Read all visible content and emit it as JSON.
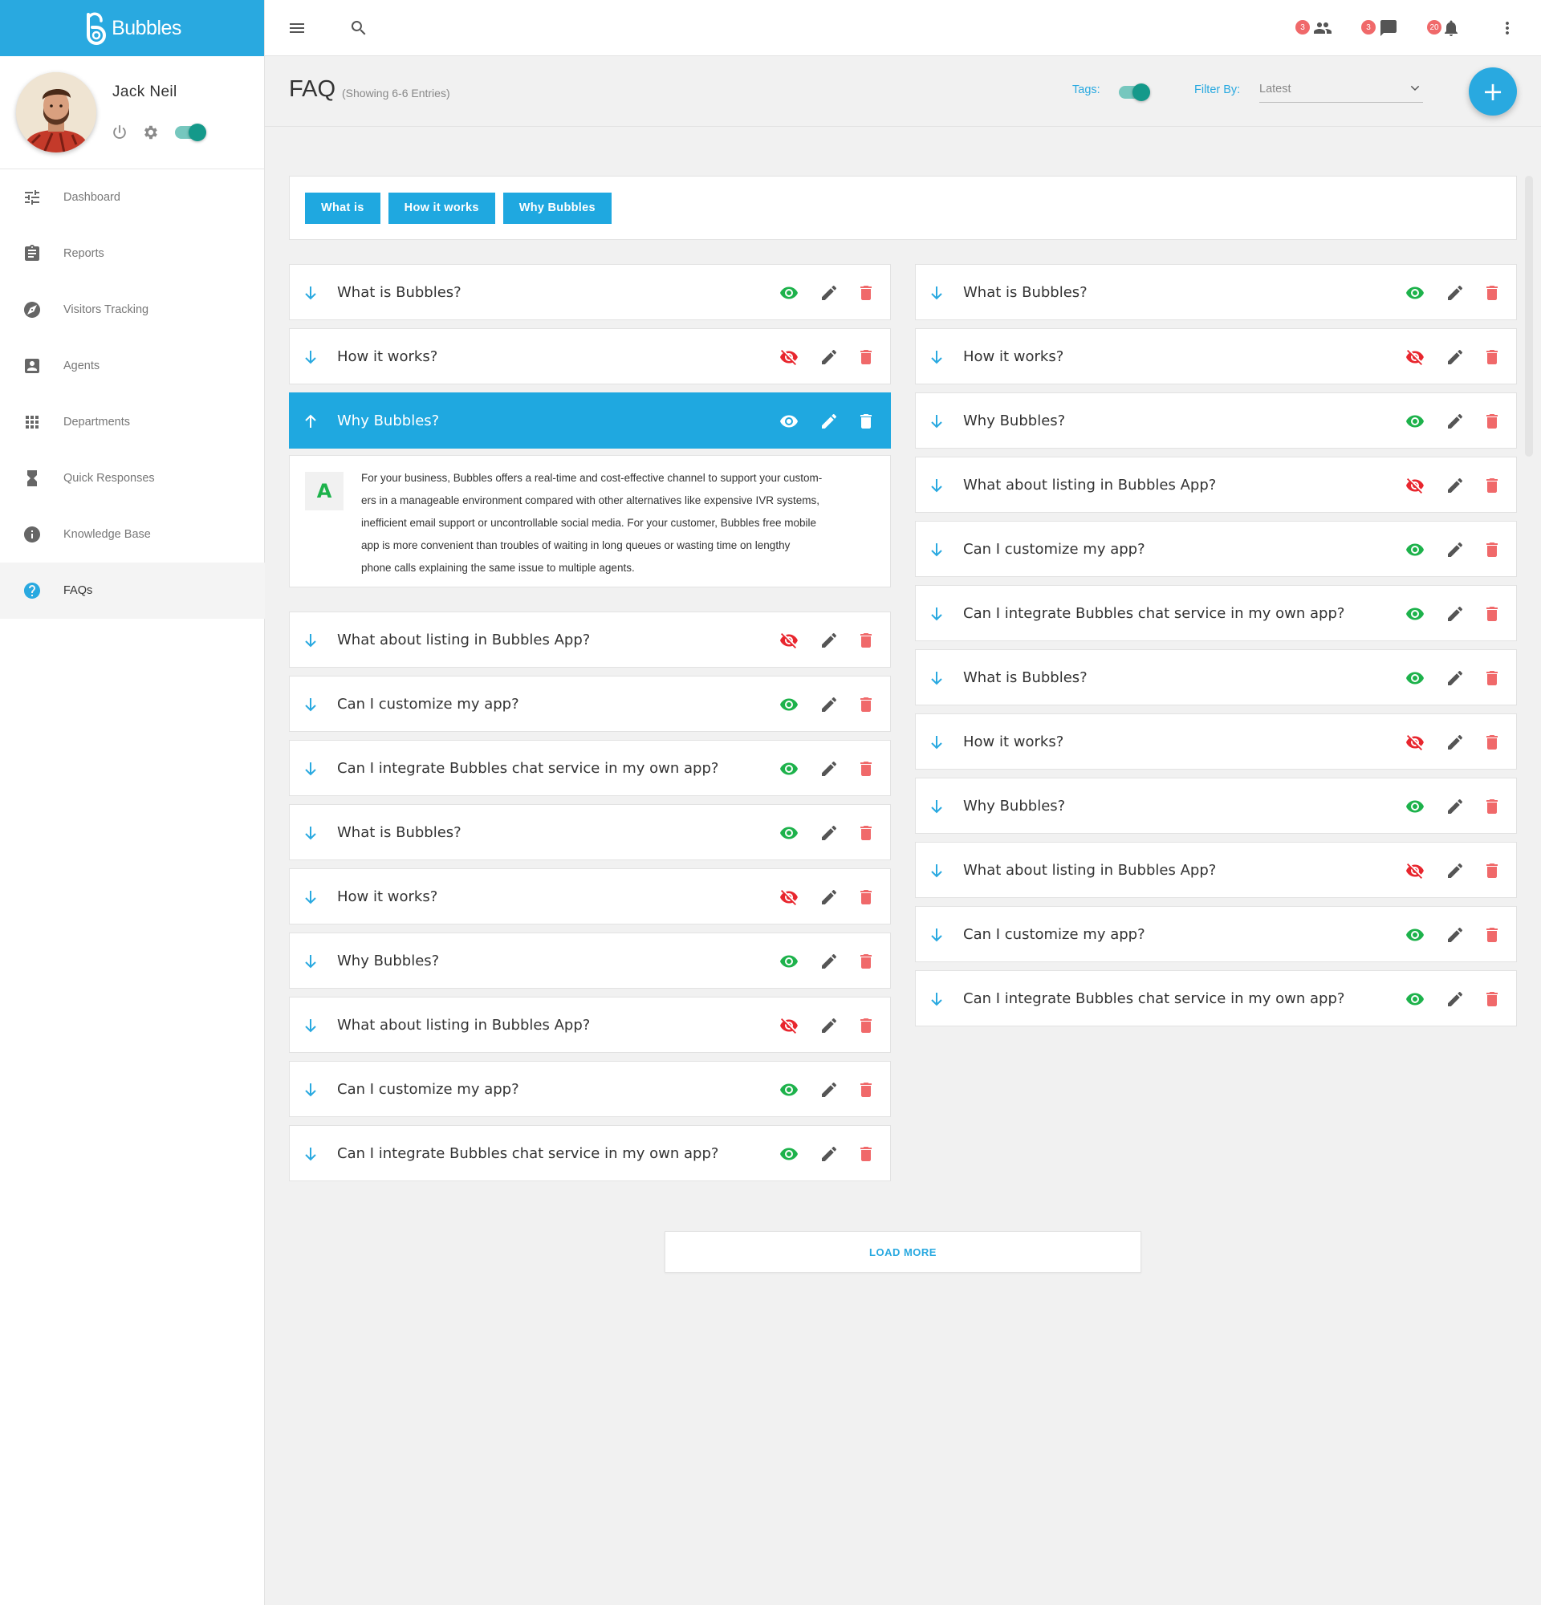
{
  "brand": {
    "name": "Bubbles"
  },
  "profile": {
    "name": "Jack Neil"
  },
  "nav": [
    {
      "label": "Dashboard",
      "icon": "sliders-icon"
    },
    {
      "label": "Reports",
      "icon": "clipboard-icon"
    },
    {
      "label": "Visitors Tracking",
      "icon": "compass-icon"
    },
    {
      "label": "Agents",
      "icon": "contact-card-icon"
    },
    {
      "label": "Departments",
      "icon": "grid-icon"
    },
    {
      "label": "Quick Responses",
      "icon": "hourglass-icon"
    },
    {
      "label": "Knowledge Base",
      "icon": "info-icon"
    },
    {
      "label": "FAQs",
      "icon": "help-icon",
      "active": true
    }
  ],
  "topbar": {
    "badges": {
      "users": "3",
      "chat": "3",
      "notifications": "20"
    }
  },
  "header": {
    "title": "FAQ",
    "subtitle": "(Showing 6-6 Entries)",
    "tags_label": "Tags:",
    "filter_label": "Filter By:",
    "filter_value": "Latest",
    "add_label": "+"
  },
  "tabs": [
    "What is",
    "How it works",
    "Why Bubbles"
  ],
  "faq_left": [
    {
      "q": "What is Bubbles?",
      "visible": true
    },
    {
      "q": "How it works?",
      "visible": false
    },
    {
      "q": "Why Bubbles?",
      "visible": true,
      "open": true
    },
    {
      "q": "What about listing in Bubbles App?",
      "visible": false
    },
    {
      "q": "Can I customize my app?",
      "visible": true
    },
    {
      "q": "Can I integrate Bubbles chat service in my own app?",
      "visible": true
    },
    {
      "q": "What is Bubbles?",
      "visible": true
    },
    {
      "q": "How it works?",
      "visible": false
    },
    {
      "q": "Why Bubbles?",
      "visible": true
    },
    {
      "q": "What about listing in Bubbles App?",
      "visible": false
    },
    {
      "q": "Can I customize my app?",
      "visible": true
    },
    {
      "q": "Can I integrate Bubbles chat service in my own app?",
      "visible": true
    }
  ],
  "faq_right": [
    {
      "q": "What is Bubbles?",
      "visible": true
    },
    {
      "q": "How it works?",
      "visible": false
    },
    {
      "q": "Why Bubbles?",
      "visible": true
    },
    {
      "q": "What about listing in Bubbles App?",
      "visible": false
    },
    {
      "q": "Can I customize my app?",
      "visible": true
    },
    {
      "q": "Can I integrate Bubbles chat service in my own app?",
      "visible": true
    },
    {
      "q": "What is Bubbles?",
      "visible": true
    },
    {
      "q": "How it works?",
      "visible": false
    },
    {
      "q": "Why Bubbles?",
      "visible": true
    },
    {
      "q": "What about listing in Bubbles App?",
      "visible": false
    },
    {
      "q": "Can I customize my app?",
      "visible": true
    },
    {
      "q": "Can I integrate Bubbles chat service in my own app?",
      "visible": true
    }
  ],
  "answer": {
    "badge": "A",
    "lines": [
      "For your business, Bubbles offers a real-time and cost-effective channel to support your custom-",
      "ers in a manageable environment compared with other alternatives like expensive IVR systems,",
      "inefficient email support or uncontrollable social media. For your customer, Bubbles free mobile",
      "app is more convenient than troubles of waiting in long queues or wasting time on lengthy",
      "phone calls explaining the same issue to multiple agents."
    ]
  },
  "load_more": "LOAD MORE",
  "colors": {
    "accent": "#29a9e0",
    "visible": "#1db24b",
    "hidden": "#e8262e",
    "delete": "#f0696a",
    "toggle": "#14998a"
  }
}
